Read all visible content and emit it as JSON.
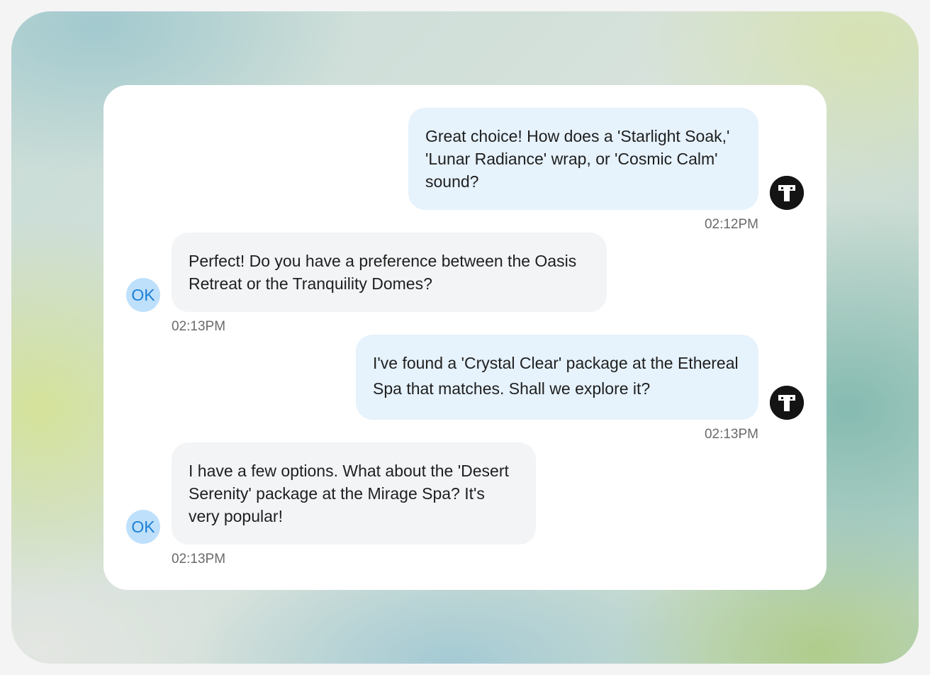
{
  "messages": [
    {
      "side": "sent",
      "text": "Great choice! How does a 'Starlight Soak,' 'Lunar Radiance' wrap, or 'Cosmic Calm' sound?",
      "time": "02:12PM",
      "avatar_icon": "t-logo-icon"
    },
    {
      "side": "received",
      "text": "Perfect! Do you have a preference between the Oasis Retreat or the Tranquility Domes?",
      "time": "02:13PM",
      "avatar_initials": "OK"
    },
    {
      "side": "sent",
      "text": "I've found a 'Crystal Clear' package at the Ethereal Spa that matches. Shall we explore it?",
      "time": "02:13PM",
      "avatar_icon": "t-logo-icon"
    },
    {
      "side": "received",
      "text": "I have a few options. What about the 'Desert Serenity' package at the Mirage Spa? It's very popular!",
      "time": "02:13PM",
      "avatar_initials": "OK"
    }
  ],
  "colors": {
    "sent_bubble": "#e6f2fc",
    "received_bubble": "#f3f4f6",
    "ok_avatar_bg": "#bfe0fb",
    "ok_avatar_text": "#1b7fd6",
    "t_avatar_bg": "#141414"
  }
}
